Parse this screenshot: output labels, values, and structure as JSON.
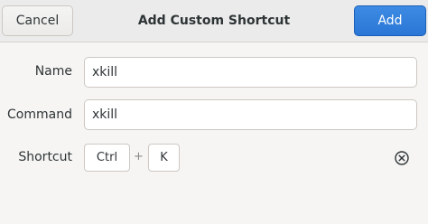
{
  "header": {
    "cancel_label": "Cancel",
    "title": "Add Custom Shortcut",
    "add_label": "Add",
    "accent_color": "#2a76d6"
  },
  "form": {
    "name_label": "Name",
    "name_value": "xkill",
    "command_label": "Command",
    "command_value": "xkill",
    "shortcut_label": "Shortcut",
    "shortcut_keys": [
      "Ctrl",
      "K"
    ],
    "shortcut_separator": "+",
    "clear_icon": "clear-circle-x-icon"
  }
}
